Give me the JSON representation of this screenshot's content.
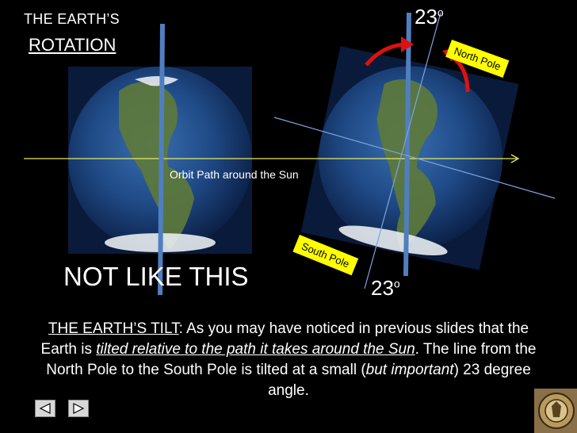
{
  "title": {
    "line1": "THE EARTH’S",
    "line2": "ROTATION"
  },
  "diagram": {
    "orbit_label": "Orbit Path around the Sun",
    "not_like_this": "NOT LIKE THIS",
    "angle_top": "23",
    "angle_bottom": "23",
    "angle_symbol": "o",
    "north_pole_label": "North Pole",
    "south_pole_label": "South Pole"
  },
  "body": {
    "heading": "THE EARTH’S TILT",
    "colon": ":",
    "text1": "  As you may have noticed in previous slides that the Earth is ",
    "emph1": "tilted relative to the path it takes around the Sun",
    "text2": ".  The line from the North Pole to the South Pole is tilted at a small (",
    "emph2": "but important",
    "text3": ") 23 degree angle."
  },
  "nav": {
    "prev_icon": "triangle-left-icon",
    "next_icon": "triangle-right-icon"
  },
  "colors": {
    "axis_blue": "#4f7fc0",
    "orbit_yellow": "#e8e86a",
    "arrow_red": "#dd1111",
    "tag_yellow": "#ffff00"
  }
}
